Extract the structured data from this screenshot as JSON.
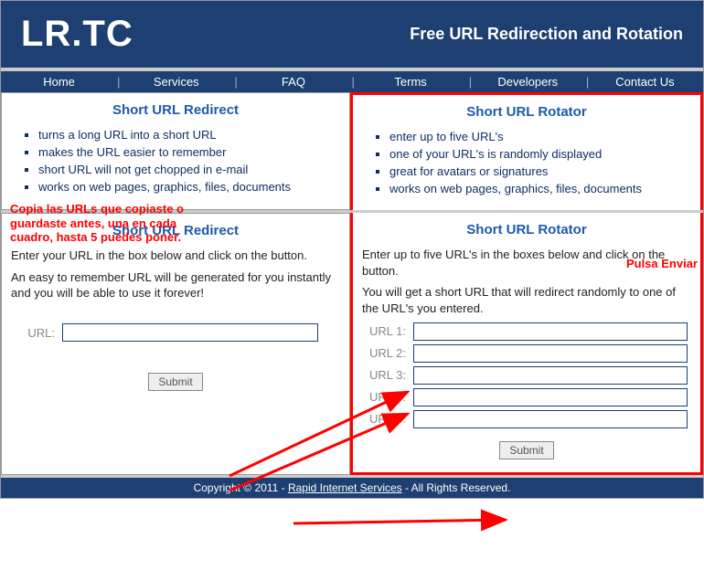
{
  "header": {
    "logo": "LR.TC",
    "tagline": "Free URL Redirection and Rotation"
  },
  "nav": [
    "Home",
    "Services",
    "FAQ",
    "Terms",
    "Developers",
    "Contact Us"
  ],
  "top_left": {
    "title": "Short URL Redirect",
    "bullets": [
      "turns a long URL into a short URL",
      "makes the URL easier to remember",
      "short URL will not get chopped in e-mail",
      "works on web pages, graphics, files, documents"
    ]
  },
  "top_right": {
    "title": "Short URL Rotator",
    "bullets": [
      "enter up to five URL's",
      "one of your URL's is randomly displayed",
      "great for avatars or signatures",
      "works on web pages, graphics, files, documents"
    ]
  },
  "bottom_left": {
    "title": "Short URL Redirect",
    "desc1": "Enter your URL in the box below and click on the button.",
    "desc2": "An easy to remember URL will be generated for you instantly and you will be able to use it forever!",
    "url_label": "URL:",
    "submit": "Submit"
  },
  "bottom_right": {
    "title": "Short URL Rotator",
    "desc1": "Enter up to five URL's in the boxes below and click on the button.",
    "desc2": "You will get a short URL that will redirect randomly to one of the URL's you entered.",
    "labels": [
      "URL 1:",
      "URL 2:",
      "URL 3:",
      "URL 4:",
      "URL 5:"
    ],
    "submit": "Submit"
  },
  "annotations": {
    "copy_urls": "Copia las URLs que copiaste o guardaste antes, una en cada cuadro, hasta 5 puedes poner.",
    "press_send": "Pulsa Enviar"
  },
  "footer": {
    "copyright_pre": "Copyright © 2011 - ",
    "link": "Rapid Internet Services",
    "copyright_post": " - All Rights Reserved."
  }
}
